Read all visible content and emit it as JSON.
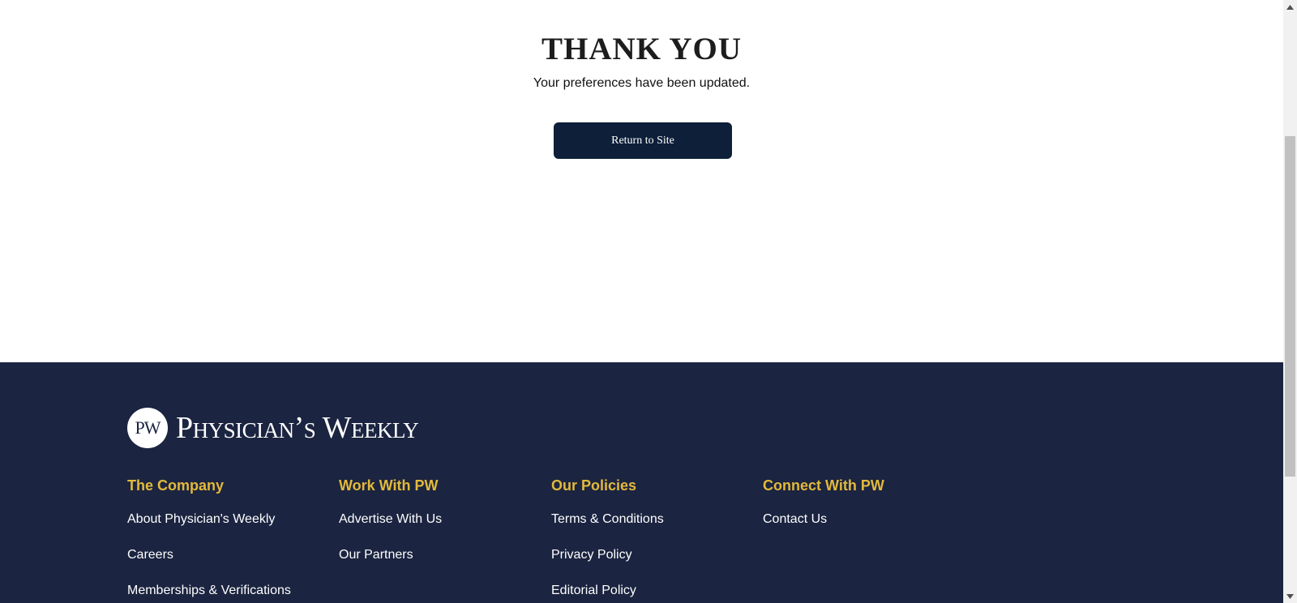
{
  "main": {
    "title": "THANK YOU",
    "subtitle": "Your preferences have been updated.",
    "return_button": "Return to Site"
  },
  "footer": {
    "logo_mark": "PW",
    "logo_text": "Physician’s Weekly",
    "columns": [
      {
        "heading": "The Company",
        "links": [
          "About Physician's Weekly",
          "Careers",
          "Memberships & Verifications"
        ]
      },
      {
        "heading": "Work With PW",
        "links": [
          "Advertise With Us",
          "Our Partners"
        ]
      },
      {
        "heading": "Our Policies",
        "links": [
          "Terms & Conditions",
          "Privacy Policy",
          "Editorial Policy"
        ]
      },
      {
        "heading": "Connect With PW",
        "links": [
          "Contact Us"
        ]
      }
    ]
  },
  "colors": {
    "button_bg": "#0d1f39",
    "footer_bg": "#1b2440",
    "heading_accent": "#e3b93b"
  },
  "icons": {
    "scroll_up": "triangle-up",
    "scroll_down": "triangle-down"
  }
}
